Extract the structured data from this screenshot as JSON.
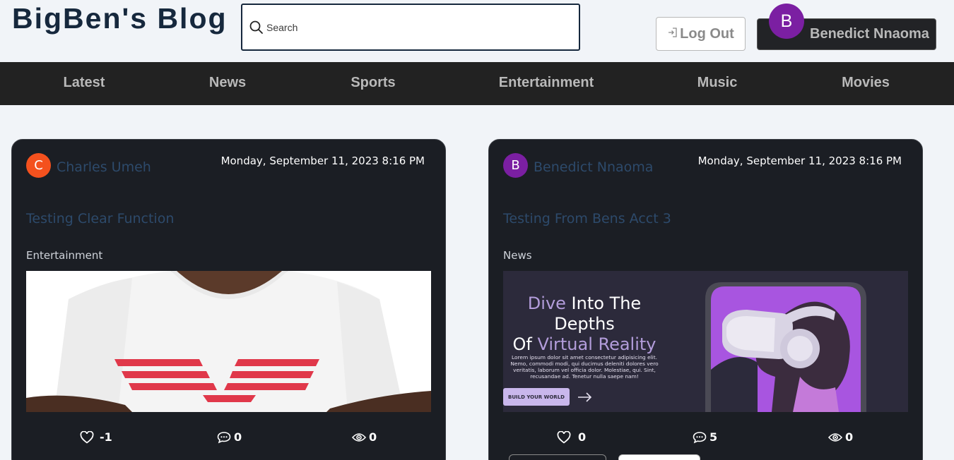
{
  "header": {
    "logo": "BigBen's Blog",
    "search_placeholder": "Search",
    "logout_label": "Log Out",
    "user_initial": "B",
    "user_name": "Benedict Nnaoma"
  },
  "nav": {
    "items": [
      "Latest",
      "News",
      "Sports",
      "Entertainment",
      "Music",
      "Movies"
    ]
  },
  "posts": [
    {
      "author_initial": "C",
      "author_color": "#f4511e",
      "author": "Charles Umeh",
      "date": "Monday, September 11, 2023 8:16 PM",
      "title": "Testing Clear Function",
      "category": "Entertainment",
      "likes": "-1",
      "comments": "0",
      "views": "0"
    },
    {
      "author_initial": "B",
      "author_color": "#7b1fa2",
      "author": "Benedict Nnaoma",
      "date": "Monday, September 11, 2023 8:16 PM",
      "title": "Testing From Bens Acct 3",
      "category": "News",
      "likes": "0",
      "comments": "5",
      "views": "0",
      "banner": {
        "line1_a": "Dive",
        "line1_b": " Into The",
        "line2": "Depths",
        "line3_a": "Of ",
        "line3_b": "Virtual Reality",
        "body1": "Lorem ipsum dolor sit amet consectetur adipisicing elit.",
        "body2": "Nemo, commodi modi, qui ducimus deleniti dolores vero",
        "body3": "veritatis, laborum vel officia dolor. Molestiae, qui. Sint,",
        "body4": "recusandae ad. Tenetur nulla saepe nam!",
        "cta": "BUILD YOUR WORLD"
      }
    }
  ]
}
